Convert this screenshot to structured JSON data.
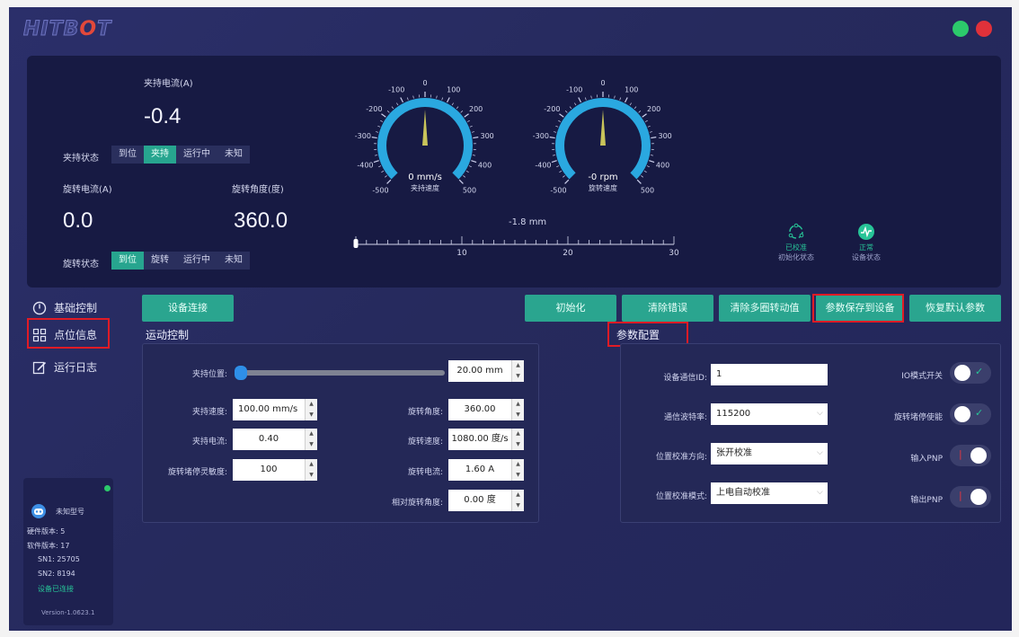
{
  "window": {
    "logo": "HITBOT",
    "status_colors": {
      "green": "#2cc96b",
      "red": "#e0313a"
    }
  },
  "top": {
    "grip_current_label": "夹持电流(A)",
    "grip_current_value": "-0.4",
    "grip_state_label": "夹持状态",
    "grip_states": [
      "到位",
      "夹持",
      "运行中",
      "未知"
    ],
    "grip_state_active": "夹持",
    "rot_current_label": "旋转电流(A)",
    "rot_current_value": "0.0",
    "rot_angle_label": "旋转角度(度)",
    "rot_angle_value": "360.0",
    "rot_state_label": "旋转状态",
    "rot_states": [
      "到位",
      "旋转",
      "运行中",
      "未知"
    ],
    "rot_state_active": "到位",
    "gauge_ticks": [
      "0",
      "100",
      "200",
      "300",
      "400",
      "500",
      "-100",
      "-200",
      "-300",
      "-400",
      "-500"
    ],
    "gauge1": {
      "value": "0 mm/s",
      "label": "夹持速度",
      "needle": 0
    },
    "gauge2": {
      "value": "-0 rpm",
      "label": "旋转速度",
      "needle": 0
    },
    "position_readout": "-1.8 mm",
    "ruler_labels": [
      "0",
      "10",
      "20",
      "30"
    ],
    "ruler_value": 0,
    "calib_status": "已校准",
    "calib_label": "初始化状态",
    "device_status": "正常",
    "device_label": "设备状态",
    "accent": "#27a58f"
  },
  "nav": {
    "items": [
      {
        "label": "基础控制",
        "icon": "power-icon"
      },
      {
        "label": "点位信息",
        "icon": "grid-icon"
      },
      {
        "label": "运行日志",
        "icon": "edit-icon"
      }
    ]
  },
  "toolbar": {
    "connect": "设备连接",
    "init": "初始化",
    "clear_error": "清除错误",
    "clear_turns": "清除多圈转动值",
    "save_params": "参数保存到设备",
    "restore_default": "恢复默认参数"
  },
  "motion": {
    "title": "运动控制",
    "grip_pos_label": "夹持位置:",
    "grip_pos_value": "20.00 mm",
    "grip_speed_label": "夹持速度:",
    "grip_speed_value": "100.00 mm/s",
    "grip_current_label": "夹持电流:",
    "grip_current_value": "0.40",
    "stall_sens_label": "旋转堵停灵敏度:",
    "stall_sens_value": "100",
    "rot_angle_label": "旋转角度:",
    "rot_angle_value": "360.00",
    "rot_speed_label": "旋转速度:",
    "rot_speed_value": "1080.00 度/s",
    "rot_current_label": "旋转电流:",
    "rot_current_value": "1.60 A",
    "rel_angle_label": "相对旋转角度:",
    "rel_angle_value": "0.00 度"
  },
  "params": {
    "title": "参数配置",
    "comm_id_label": "设备通信ID:",
    "comm_id_value": "1",
    "baud_label": "通信波特率:",
    "baud_value": "115200",
    "calib_dir_label": "位置校准方向:",
    "calib_dir_value": "张开校准",
    "calib_mode_label": "位置校准模式:",
    "calib_mode_value": "上电自动校准",
    "io_mode_label": "IO模式开关",
    "stall_enable_label": "旋转堵停使能",
    "input_pnp_label": "输入PNP",
    "output_pnp_label": "输出PNP"
  },
  "device": {
    "model": "未知型号",
    "hw": "硬件版本: 5",
    "sw": "软件版本: 17",
    "sn1": "SN1: 25705",
    "sn2": "SN2: 8194",
    "connected": "设备已连接",
    "version": "Version-1.0623.1"
  }
}
